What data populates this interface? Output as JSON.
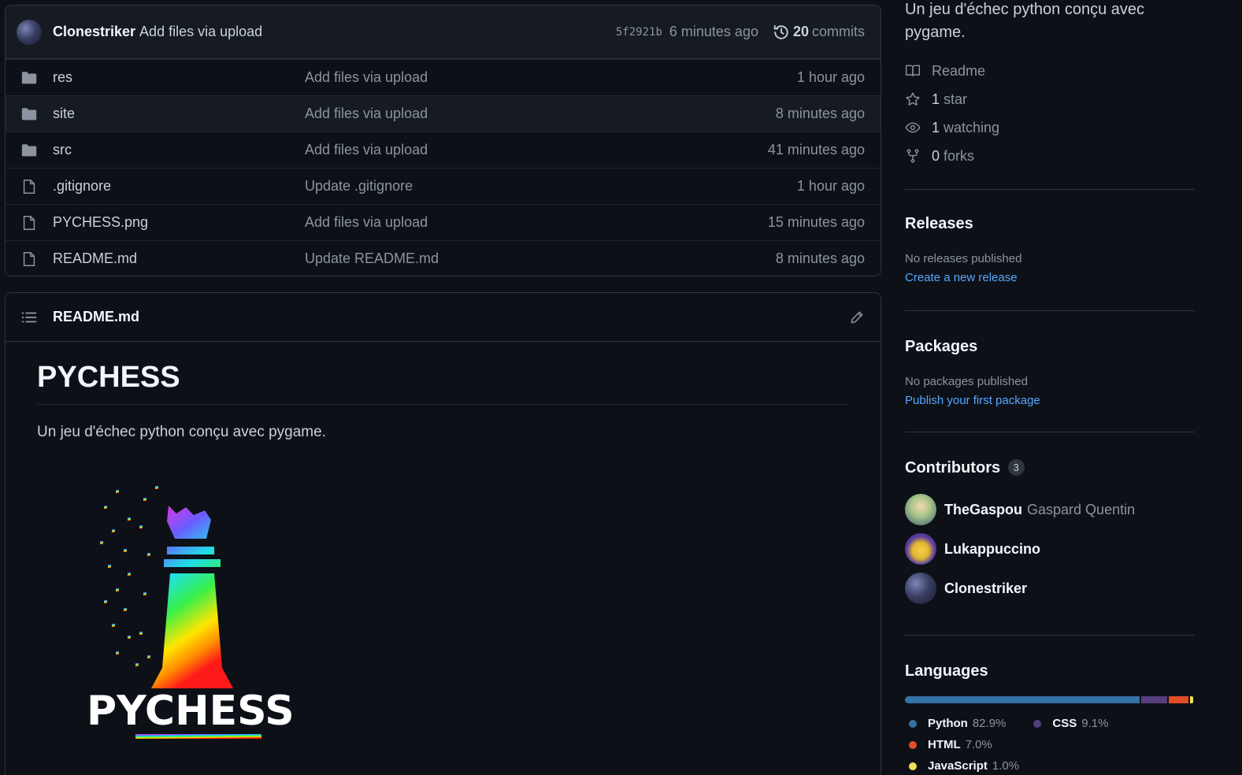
{
  "commit": {
    "author": "Clonestriker",
    "message": "Add files via upload",
    "sha": "5f2921b",
    "time": "6 minutes ago",
    "count": "20",
    "count_label": "commits"
  },
  "files": [
    {
      "name": "res",
      "type": "folder",
      "commit": "Add files via upload",
      "time": "1 hour ago"
    },
    {
      "name": "site",
      "type": "folder",
      "commit": "Add files via upload",
      "time": "8 minutes ago"
    },
    {
      "name": "src",
      "type": "folder",
      "commit": "Add files via upload",
      "time": "41 minutes ago"
    },
    {
      "name": ".gitignore",
      "type": "file",
      "commit": "Update .gitignore",
      "time": "1 hour ago"
    },
    {
      "name": "PYCHESS.png",
      "type": "file",
      "commit": "Add files via upload",
      "time": "15 minutes ago"
    },
    {
      "name": "README.md",
      "type": "file",
      "commit": "Update README.md",
      "time": "8 minutes ago"
    }
  ],
  "readme": {
    "filename": "README.md",
    "heading": "PYCHESS",
    "paragraph": "Un jeu d'échec python conçu avec pygame.",
    "logo_text": "PYCHESS"
  },
  "about": {
    "description": "Un jeu d'échec python conçu avec pygame.",
    "readme_label": "Readme",
    "stars": "1",
    "stars_label": "star",
    "watching": "1",
    "watching_label": "watching",
    "forks": "0",
    "forks_label": "forks"
  },
  "releases": {
    "title": "Releases",
    "empty": "No releases published",
    "link": "Create a new release"
  },
  "packages": {
    "title": "Packages",
    "empty": "No packages published",
    "link": "Publish your first package"
  },
  "contributors": {
    "title": "Contributors",
    "count": "3",
    "list": [
      {
        "login": "TheGaspou",
        "name": "Gaspard Quentin"
      },
      {
        "login": "Lukappuccino",
        "name": ""
      },
      {
        "login": "Clonestriker",
        "name": ""
      }
    ]
  },
  "languages": {
    "title": "Languages",
    "list": [
      {
        "name": "Python",
        "pct": "82.9%",
        "value": 82.9,
        "color": "#3572A5"
      },
      {
        "name": "CSS",
        "pct": "9.1%",
        "value": 9.1,
        "color": "#563d7c"
      },
      {
        "name": "HTML",
        "pct": "7.0%",
        "value": 7.0,
        "color": "#e34c26"
      },
      {
        "name": "JavaScript",
        "pct": "1.0%",
        "value": 1.0,
        "color": "#f1e05a"
      }
    ]
  }
}
